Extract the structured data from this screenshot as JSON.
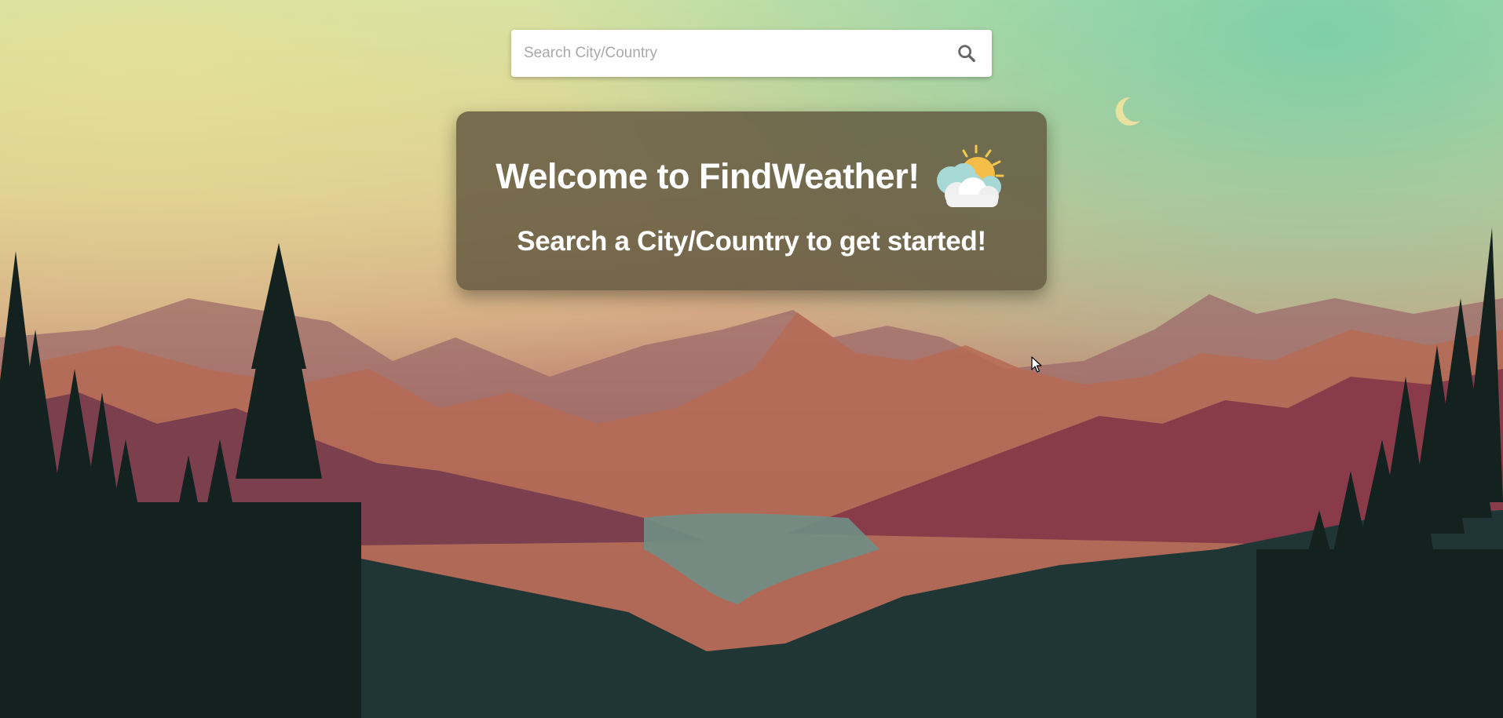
{
  "search": {
    "placeholder": "Search City/Country",
    "value": "",
    "icon": "search-icon"
  },
  "welcome": {
    "title": "Welcome to FindWeather!",
    "subtitle": "Search a City/Country to get started!",
    "icon": "sun-behind-clouds-icon"
  },
  "background": {
    "scene": "mountain-lake-sunset",
    "moon_icon": "crescent-moon-icon"
  },
  "colors": {
    "card_background": "#60563e",
    "text": "#ffffff",
    "search_background": "#ffffff",
    "placeholder": "#a8a8a8",
    "search_icon": "#666666"
  }
}
